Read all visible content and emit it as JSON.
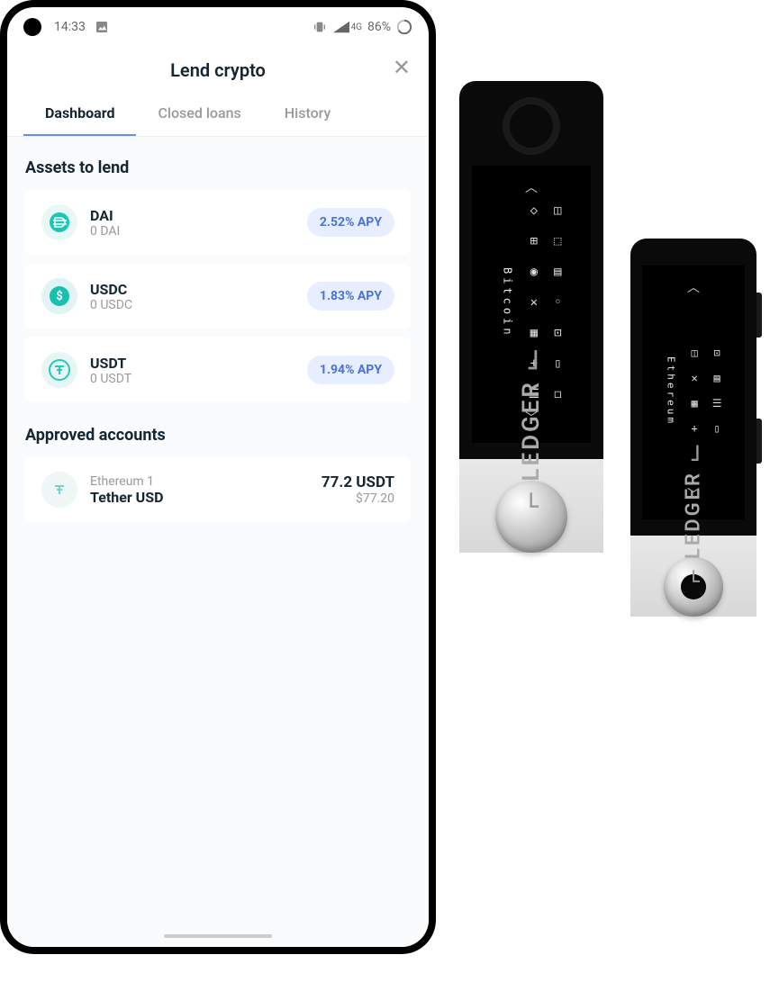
{
  "status_bar": {
    "time": "14:33",
    "network": "4G",
    "battery": "86%"
  },
  "header": {
    "title": "Lend crypto"
  },
  "tabs": [
    {
      "label": "Dashboard",
      "active": true
    },
    {
      "label": "Closed loans",
      "active": false
    },
    {
      "label": "History",
      "active": false
    }
  ],
  "sections": {
    "assets_title": "Assets to lend",
    "approved_title": "Approved accounts"
  },
  "assets": [
    {
      "symbol": "DAI",
      "balance": "0 DAI",
      "apy": "2.52% APY",
      "icon_bg": "#e8f8f7",
      "icon_fg": "#1ac7b6"
    },
    {
      "symbol": "USDC",
      "balance": "0 USDC",
      "apy": "1.83% APY",
      "icon_bg": "#e0f5f3",
      "icon_fg": "#15c2af"
    },
    {
      "symbol": "USDT",
      "balance": "0 USDT",
      "apy": "1.94% APY",
      "icon_bg": "#e6f6f4",
      "icon_fg": "#27c9b8"
    }
  ],
  "approved": [
    {
      "account": "Ethereum 1",
      "asset": "Tether USD",
      "amount": "77.2 USDT",
      "fiat": "$77.20"
    }
  ],
  "devices": [
    {
      "label": "Bitcoin",
      "brand": "LEDGER"
    },
    {
      "label": "Ethereum",
      "brand": "LEDGER"
    }
  ]
}
